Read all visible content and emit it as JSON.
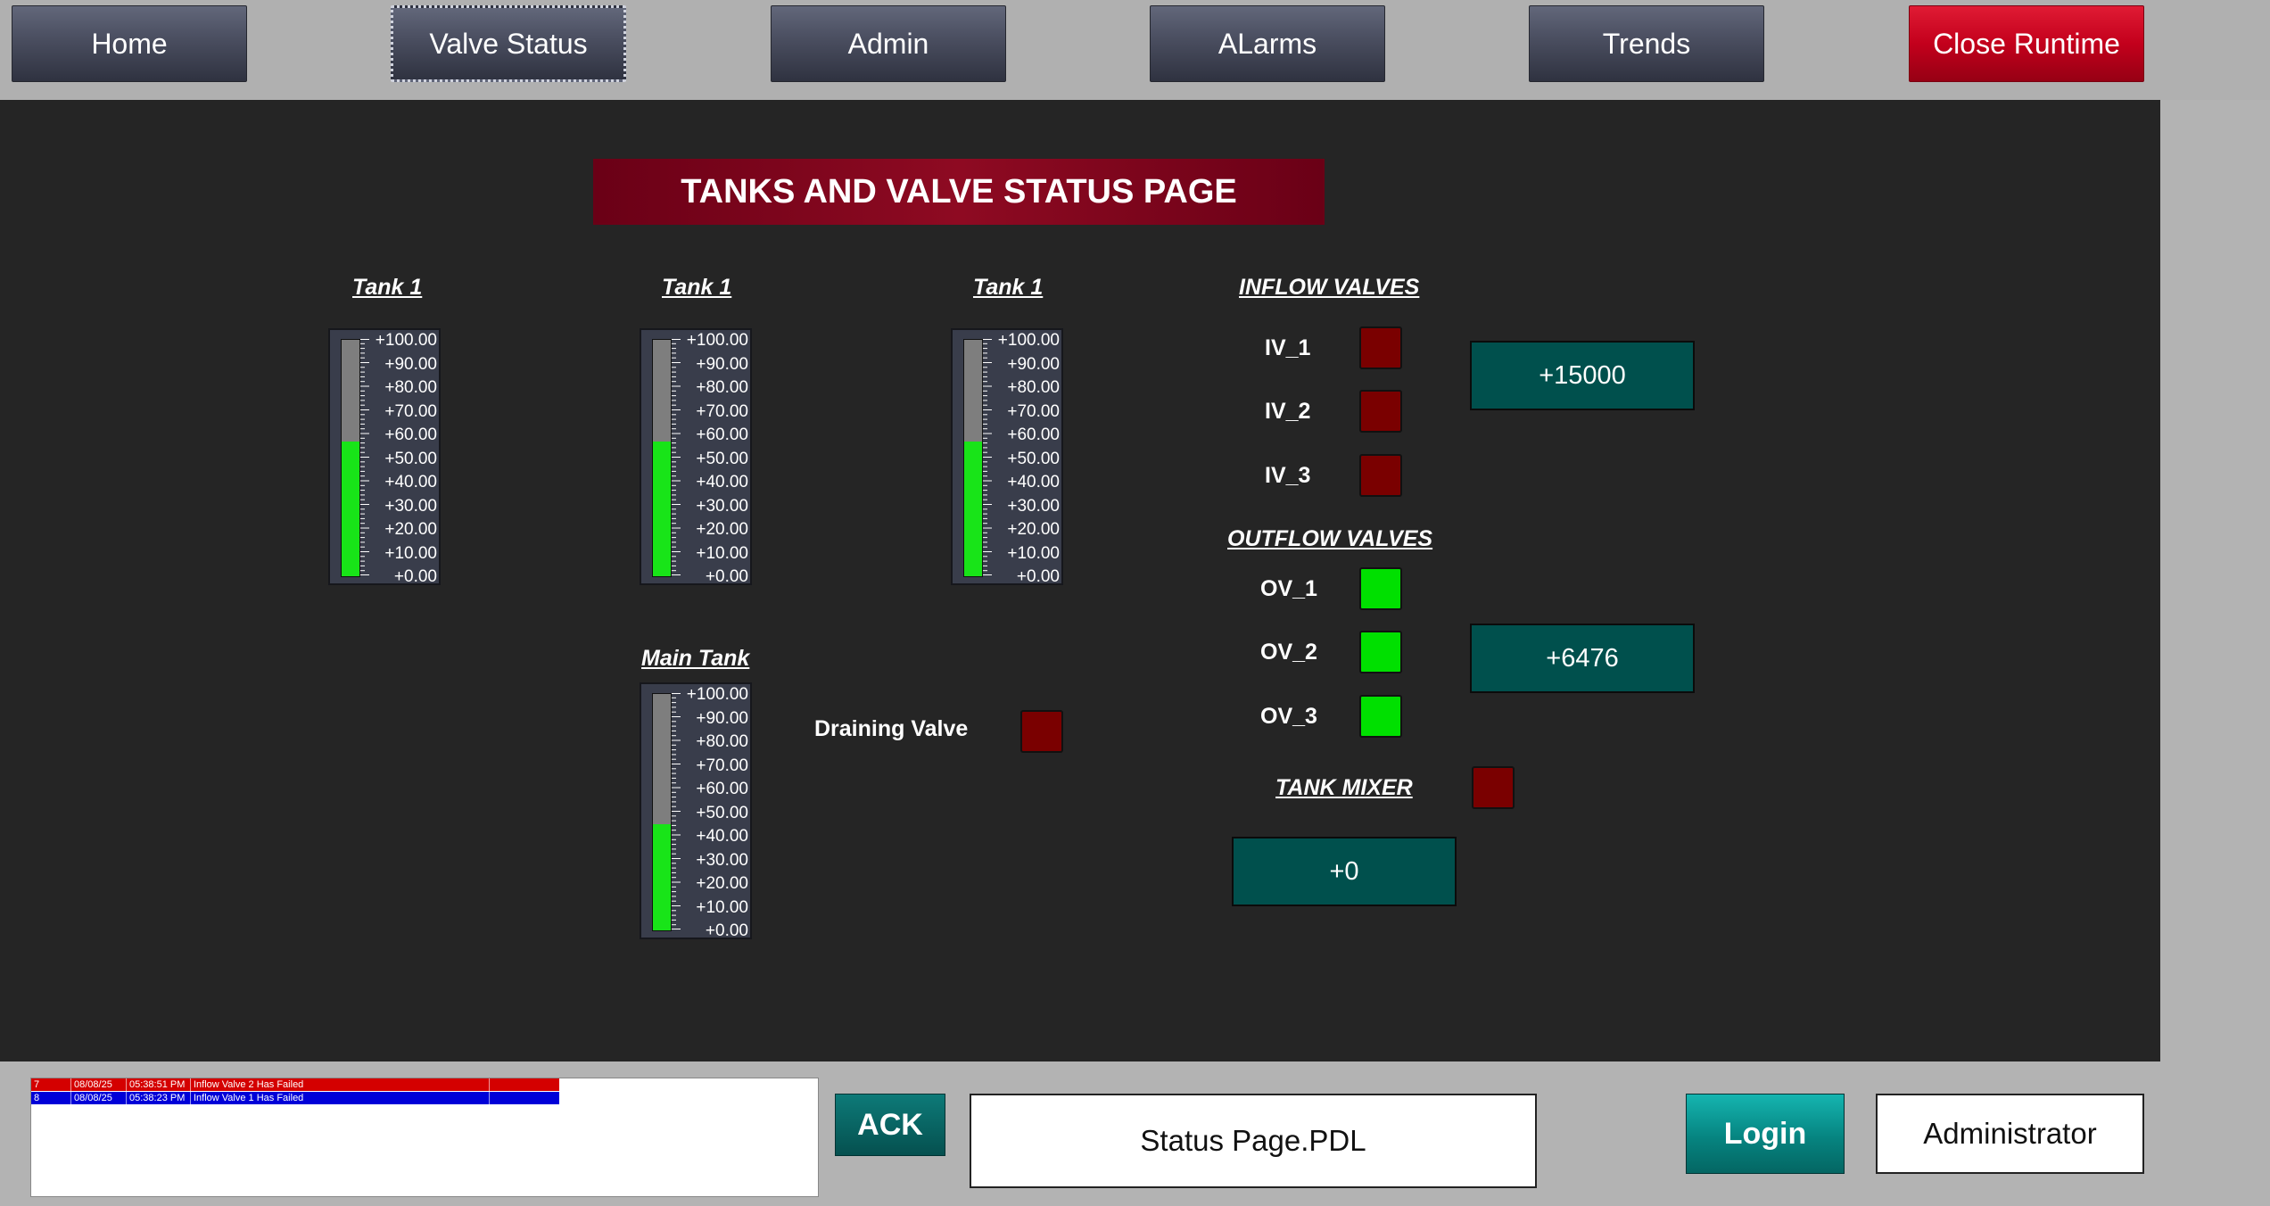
{
  "nav": {
    "home": "Home",
    "valve_status": "Valve Status",
    "admin": "Admin",
    "alarms": "ALarms",
    "trends": "Trends",
    "close_runtime": "Close Runtime"
  },
  "page_title": "TANKS AND VALVE STATUS PAGE",
  "scale_labels": [
    "+100.00",
    "+90.00",
    "+80.00",
    "+70.00",
    "+60.00",
    "+50.00",
    "+40.00",
    "+30.00",
    "+20.00",
    "+10.00",
    "+0.00"
  ],
  "tanks": [
    {
      "label": "Tank 1",
      "level_percent": 57
    },
    {
      "label": "Tank 1",
      "level_percent": 57
    },
    {
      "label": "Tank 1",
      "level_percent": 57
    },
    {
      "label": "Main Tank",
      "level_percent": 45
    }
  ],
  "draining_valve": {
    "label": "Draining Valve",
    "state": "off"
  },
  "inflow": {
    "header": "INFLOW VALVES",
    "valves": [
      {
        "label": "IV_1",
        "state": "off"
      },
      {
        "label": "IV_2",
        "state": "off"
      },
      {
        "label": "IV_3",
        "state": "off"
      }
    ],
    "value": "+15000"
  },
  "outflow": {
    "header": "OUTFLOW VALVES",
    "valves": [
      {
        "label": "OV_1",
        "state": "on"
      },
      {
        "label": "OV_2",
        "state": "on"
      },
      {
        "label": "OV_3",
        "state": "on"
      }
    ],
    "value": "+6476"
  },
  "mixer": {
    "label": "TANK MIXER",
    "state": "off",
    "value": "+0"
  },
  "alarms": [
    {
      "id": "7",
      "date": "08/08/25",
      "time": "05:38:51 PM",
      "message": "Inflow Valve 2 Has Failed",
      "color": "#d40000"
    },
    {
      "id": "8",
      "date": "08/08/25",
      "time": "05:38:23 PM",
      "message": "Inflow Valve 1 Has Failed",
      "color": "#0000d8"
    }
  ],
  "ack_label": "ACK",
  "current_page": "Status Page.PDL",
  "login_label": "Login",
  "user": "Administrator",
  "colors": {
    "valve_on": "#00e000",
    "valve_off": "#7a0000",
    "tank_fill": "#18e418"
  }
}
